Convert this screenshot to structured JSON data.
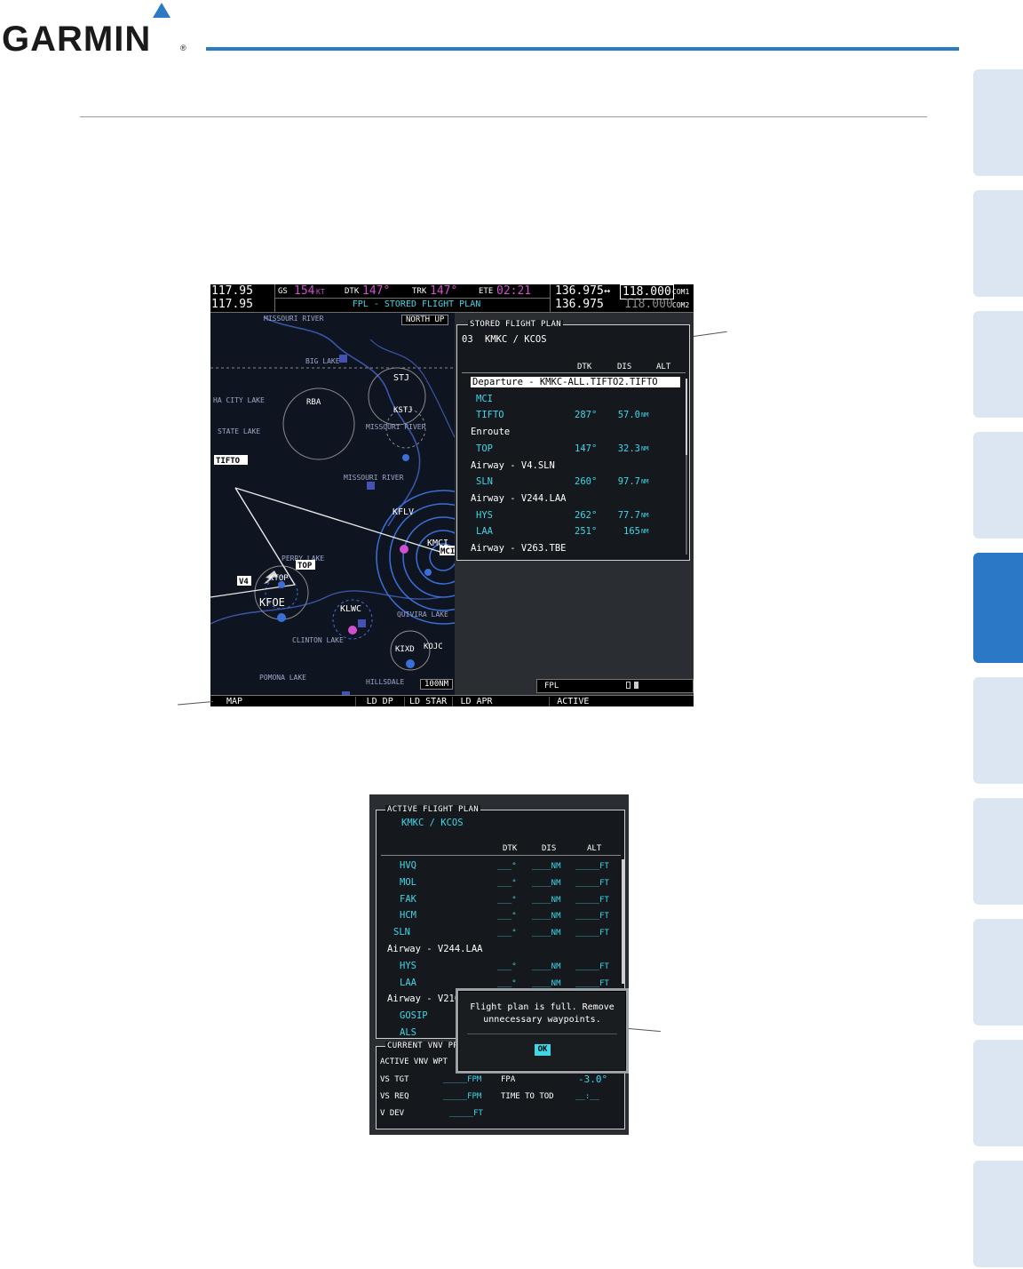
{
  "brand": {
    "name": "GARMIN",
    "reg": "®",
    "color": "#1a1a1a",
    "accent": "#2b7bc3"
  },
  "side_tabs": {
    "count": 10,
    "active_index": 5
  },
  "mfd": {
    "com_standby_1": "117.95",
    "com_standby_2": "117.95",
    "gs_label": "GS",
    "gs_value": "154",
    "gs_unit": "KT",
    "dtk_label": "DTK",
    "dtk_value": "147°",
    "trk_label": "TRK",
    "trk_value": "147°",
    "ete_label": "ETE",
    "ete_value": "02:21",
    "page_title": "FPL - STORED FLIGHT PLAN",
    "com1_active": "136.975",
    "com1_arrow": "↔",
    "com1_standby": "118.000",
    "com1_label": "COM1",
    "com2_active": "136.975",
    "com2_standby": "118.000",
    "com2_label": "COM2",
    "north_up": "NORTH UP",
    "range": "100NM",
    "map_labels": {
      "missouri_river_1": "MISSOURI RIVER",
      "big_lake": "BIG LAKE",
      "city_lake": "HA CITY LAKE",
      "rba": "RBA",
      "stj": "STJ",
      "kstj": "KSTJ",
      "missouri_river_2": "MISSOURI RIVER",
      "state_lake": "STATE LAKE",
      "tifto": "TIFTO",
      "missouri_river_3": "MISSOURI RIVER",
      "kflv": "KFLV",
      "kmci": "KMCI",
      "mci": "MCI",
      "perry_lake": "PERRY LAKE",
      "top": "TOP",
      "v4": "V4",
      "ktop": "KTOP",
      "kfoe": "KFOE",
      "klwc": "KLWC",
      "quivira_lake": "QUIVIRA LAKE",
      "clinton_lake": "CLINTON LAKE",
      "kixd": "KIXD",
      "kojc": "KOJC",
      "pomona_lake": "POMONA LAKE",
      "hillsdale": "HILLSDALE"
    },
    "stored_fp": {
      "box_title": "STORED FLIGHT PLAN",
      "plan_id": "03",
      "plan_route": "KMKC / KCOS",
      "col_dtk": "DTK",
      "col_dis": "DIS",
      "col_alt": "ALT",
      "rows": [
        {
          "name": "Departure - KMKC-ALL.TIFTO2.TIFTO",
          "dtk": "",
          "dis": "",
          "unit": "",
          "kind": "header-selected"
        },
        {
          "name": "MCI",
          "dtk": "",
          "dis": "",
          "unit": "",
          "kind": "wpt"
        },
        {
          "name": "TIFTO",
          "dtk": "287°",
          "dis": "57.0",
          "unit": "NM",
          "kind": "wpt"
        },
        {
          "name": "Enroute",
          "dtk": "",
          "dis": "",
          "unit": "",
          "kind": "header"
        },
        {
          "name": "TOP",
          "dtk": "147°",
          "dis": "32.3",
          "unit": "NM",
          "kind": "wpt"
        },
        {
          "name": "Airway - V4.SLN",
          "dtk": "",
          "dis": "",
          "unit": "",
          "kind": "header"
        },
        {
          "name": "SLN",
          "dtk": "260°",
          "dis": "97.7",
          "unit": "NM",
          "kind": "wpt"
        },
        {
          "name": "Airway - V244.LAA",
          "dtk": "",
          "dis": "",
          "unit": "",
          "kind": "header"
        },
        {
          "name": "HYS",
          "dtk": "262°",
          "dis": "77.7",
          "unit": "NM",
          "kind": "wpt"
        },
        {
          "name": "LAA",
          "dtk": "251°",
          "dis": "165",
          "unit": "NM",
          "kind": "wpt"
        },
        {
          "name": "Airway - V263.TBE",
          "dtk": "",
          "dis": "",
          "unit": "",
          "kind": "header"
        }
      ]
    },
    "fpl_label": "FPL",
    "softkeys": [
      "MAP",
      "",
      "",
      "LD DP",
      "LD STAR",
      "LD APR",
      "",
      "ACTIVE",
      "",
      ""
    ],
    "softkeys_active": [
      true,
      false,
      false,
      true,
      true,
      true,
      false,
      true,
      false,
      false
    ]
  },
  "afp": {
    "box_title": "ACTIVE FLIGHT PLAN",
    "route": "KMKC / KCOS",
    "col_dtk": "DTK",
    "col_dis": "DIS",
    "col_alt": "ALT",
    "rows": [
      {
        "name": "HVQ",
        "kind": "wpt"
      },
      {
        "name": "MOL",
        "kind": "wpt"
      },
      {
        "name": "FAK",
        "kind": "wpt"
      },
      {
        "name": "HCM",
        "kind": "wpt"
      },
      {
        "name": "SLN",
        "kind": "wpt2"
      },
      {
        "name": "Airway - V244.LAA",
        "kind": "header"
      },
      {
        "name": "HYS",
        "kind": "wpt"
      },
      {
        "name": "LAA",
        "kind": "wpt"
      },
      {
        "name": "Airway - V210.",
        "kind": "header"
      },
      {
        "name": "GOSIP",
        "kind": "wpt"
      },
      {
        "name": "ALS",
        "kind": "wpt"
      }
    ],
    "dtk_blank": "___°",
    "dis_blank": "____NM",
    "alt_blank": "_____FT",
    "popup_line1": "Flight plan is full. Remove",
    "popup_line2": "unnecessary waypoints.",
    "popup_ok": "OK",
    "vnv": {
      "box_title": "CURRENT VNV PR",
      "active_vnv_wpt": "ACTIVE VNV WPT",
      "vs_tgt": "VS TGT",
      "vs_tgt_val": "_____FPM",
      "fpa": "FPA",
      "fpa_val": "-3.0°",
      "vs_req": "VS REQ",
      "vs_req_val": "_____FPM",
      "time_to_tod": "TIME TO TOD",
      "time_to_tod_val": "__:__",
      "v_dev": "V DEV",
      "v_dev_val": "_____FT"
    }
  }
}
